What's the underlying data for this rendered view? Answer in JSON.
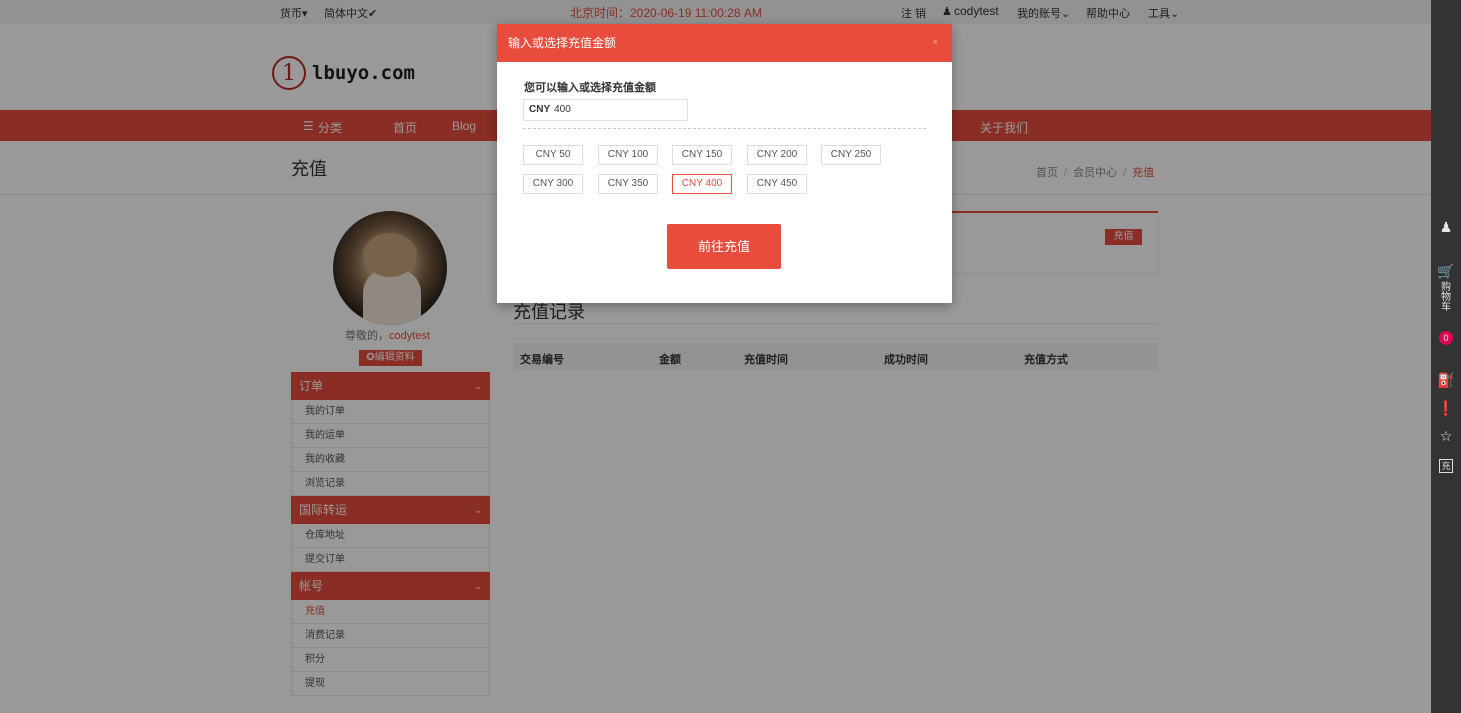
{
  "topbar": {
    "currency": "货币▾",
    "language": "简体中文✔",
    "time": "北京时间：2020-06-19 11:00:28 AM",
    "logout": "注 销",
    "user": "codytest",
    "my_account": "我的账号⌄",
    "help": "帮助中心",
    "tools": "工具⌄"
  },
  "logo": {
    "mark": "1",
    "text": "lbuyo.com"
  },
  "nav": {
    "category": "分类",
    "home": "首页",
    "blog": "Blog",
    "about": "关于我们"
  },
  "page": {
    "title": "充值"
  },
  "breadcrumb": {
    "home": "首页",
    "member": "会员中心",
    "current": "充值",
    "sep": "/"
  },
  "profile": {
    "greeting": "尊敬的，",
    "username": "codytest",
    "edit": "✪编辑资料"
  },
  "sidebar": {
    "groups": [
      {
        "title": "订单",
        "items": [
          "我的订单",
          "我的运单",
          "我的收藏",
          "浏览记录"
        ]
      },
      {
        "title": "国际转运",
        "items": [
          "仓库地址",
          "提交订单"
        ]
      },
      {
        "title": "帐号",
        "items": [
          "充值",
          "消费记录",
          "积分",
          "提现"
        ]
      }
    ]
  },
  "content": {
    "recharge_button": "充值",
    "records_title": "充值记录",
    "table_headers": [
      "交易编号",
      "金额",
      "充值时间",
      "成功时间",
      "充值方式"
    ]
  },
  "rail": {
    "cart": [
      "购",
      "物",
      "车"
    ],
    "cart_count": "0",
    "recharge": "充"
  },
  "modal": {
    "title": "输入或选择充值金额",
    "close": "×",
    "label": "您可以输入或选择充值金额",
    "currency": "CNY",
    "amount": "400",
    "options": [
      "CNY 50",
      "CNY 100",
      "CNY 150",
      "CNY 200",
      "CNY 250",
      "CNY 300",
      "CNY 350",
      "CNY 400",
      "CNY 450"
    ],
    "selected_option": "CNY 400",
    "submit": "前往充值"
  },
  "colors": {
    "accent": "#e74c3c",
    "rail": "#333333",
    "badge": "#e10050"
  }
}
